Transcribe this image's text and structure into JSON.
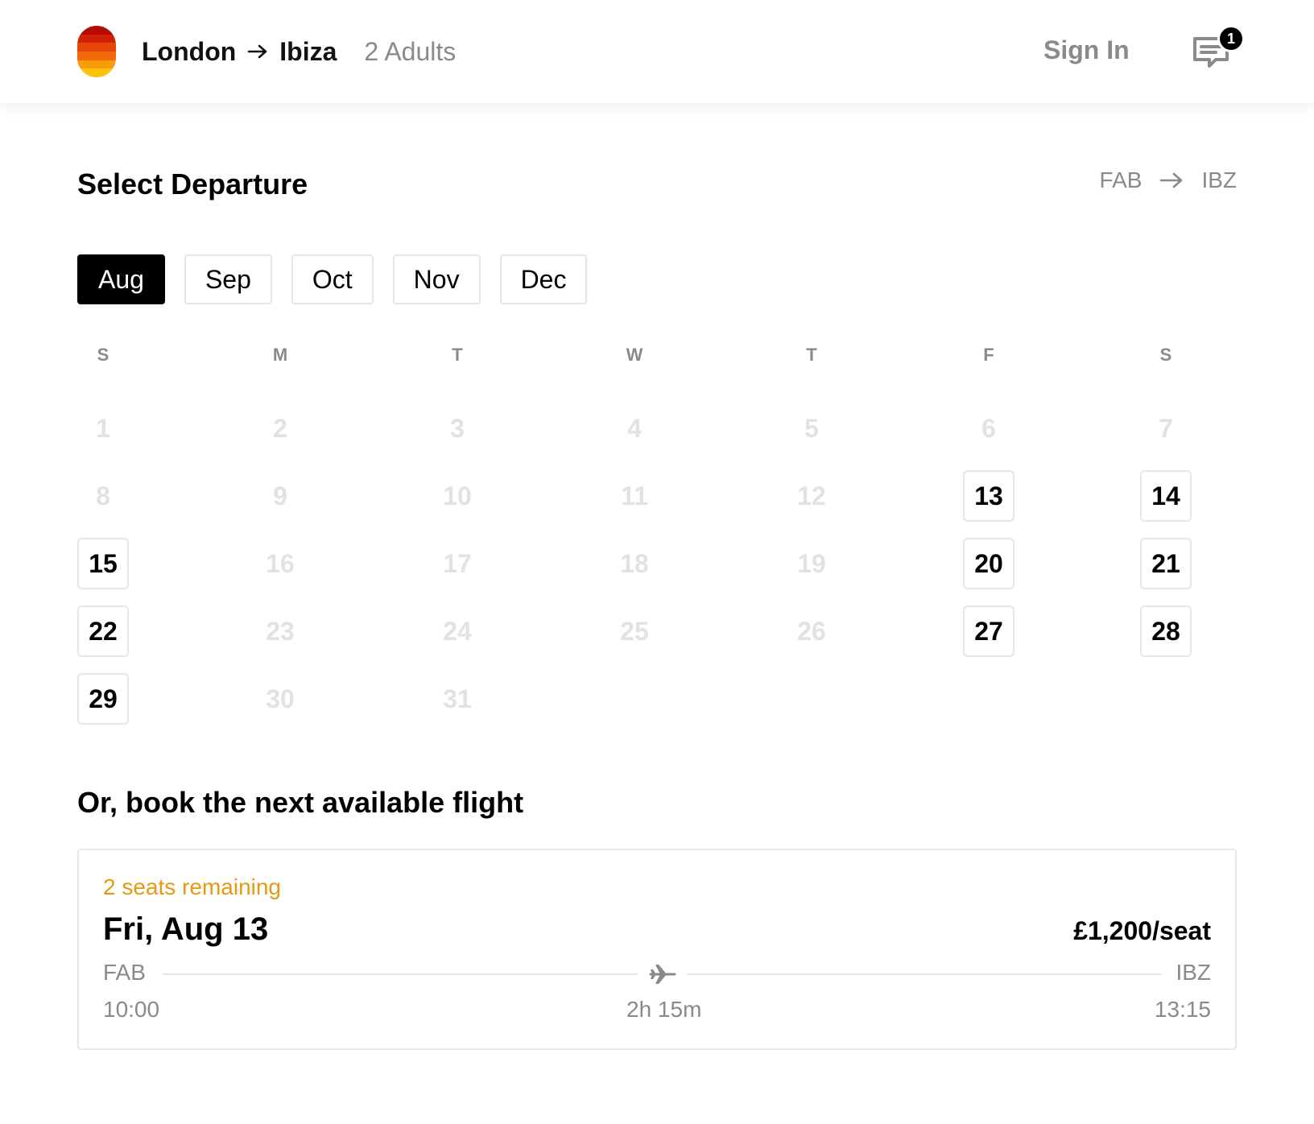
{
  "header": {
    "origin": "London",
    "destination": "Ibiza",
    "passengers": "2 Adults",
    "sign_in": "Sign In",
    "notification_count": "1",
    "logo_colors": [
      "#b50d06",
      "#d02006",
      "#e7450a",
      "#f36b09",
      "#f99a08",
      "#fcc009"
    ]
  },
  "page": {
    "title": "Select Departure",
    "from_code": "FAB",
    "to_code": "IBZ"
  },
  "months": [
    {
      "label": "Aug",
      "selected": true
    },
    {
      "label": "Sep",
      "selected": false
    },
    {
      "label": "Oct",
      "selected": false
    },
    {
      "label": "Nov",
      "selected": false
    },
    {
      "label": "Dec",
      "selected": false
    }
  ],
  "calendar": {
    "weekdays": [
      "S",
      "M",
      "T",
      "W",
      "T",
      "F",
      "S"
    ],
    "first_weekday_index": 0,
    "days_in_month": 31,
    "available_days": [
      13,
      14,
      15,
      20,
      21,
      22,
      27,
      28,
      29
    ]
  },
  "next_flight": {
    "heading": "Or, book the next available flight",
    "seats_remaining": "2 seats remaining",
    "date": "Fri, Aug 13",
    "price": "£1,200/seat",
    "from_code": "FAB",
    "to_code": "IBZ",
    "departure_time": "10:00",
    "duration": "2h 15m",
    "arrival_time": "13:15"
  },
  "colors": {
    "accent": "#000000",
    "muted": "#8a8a8a",
    "disabled_day": "#e2e2e2",
    "warning": "#e69a12"
  }
}
